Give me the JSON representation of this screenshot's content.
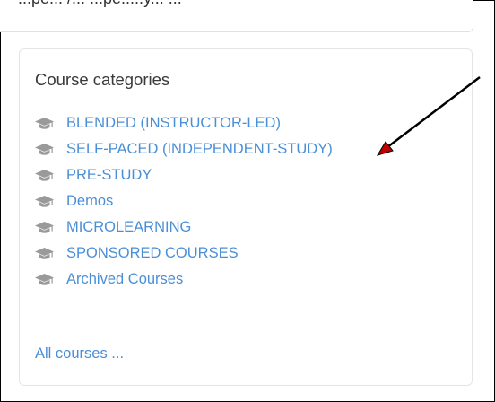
{
  "top_text": "...pe... /... ...pe.....y... ...",
  "categories_block": {
    "title": "Course categories",
    "items": [
      {
        "label": "BLENDED (INSTRUCTOR-LED)",
        "icon": "graduation-cap-icon"
      },
      {
        "label": "SELF-PACED (INDEPENDENT-STUDY)",
        "icon": "graduation-cap-icon"
      },
      {
        "label": "PRE-STUDY",
        "icon": "graduation-cap-icon"
      },
      {
        "label": "Demos",
        "icon": "graduation-cap-icon"
      },
      {
        "label": "MICROLEARNING",
        "icon": "graduation-cap-icon"
      },
      {
        "label": "SPONSORED COURSES",
        "icon": "graduation-cap-icon"
      },
      {
        "label": "Archived Courses",
        "icon": "graduation-cap-icon"
      }
    ],
    "all_courses": "All courses ..."
  },
  "colors": {
    "link": "#4a8fd6",
    "icon": "#9a9a9a",
    "arrow_shaft": "#000000",
    "arrow_head": "#c00000"
  }
}
